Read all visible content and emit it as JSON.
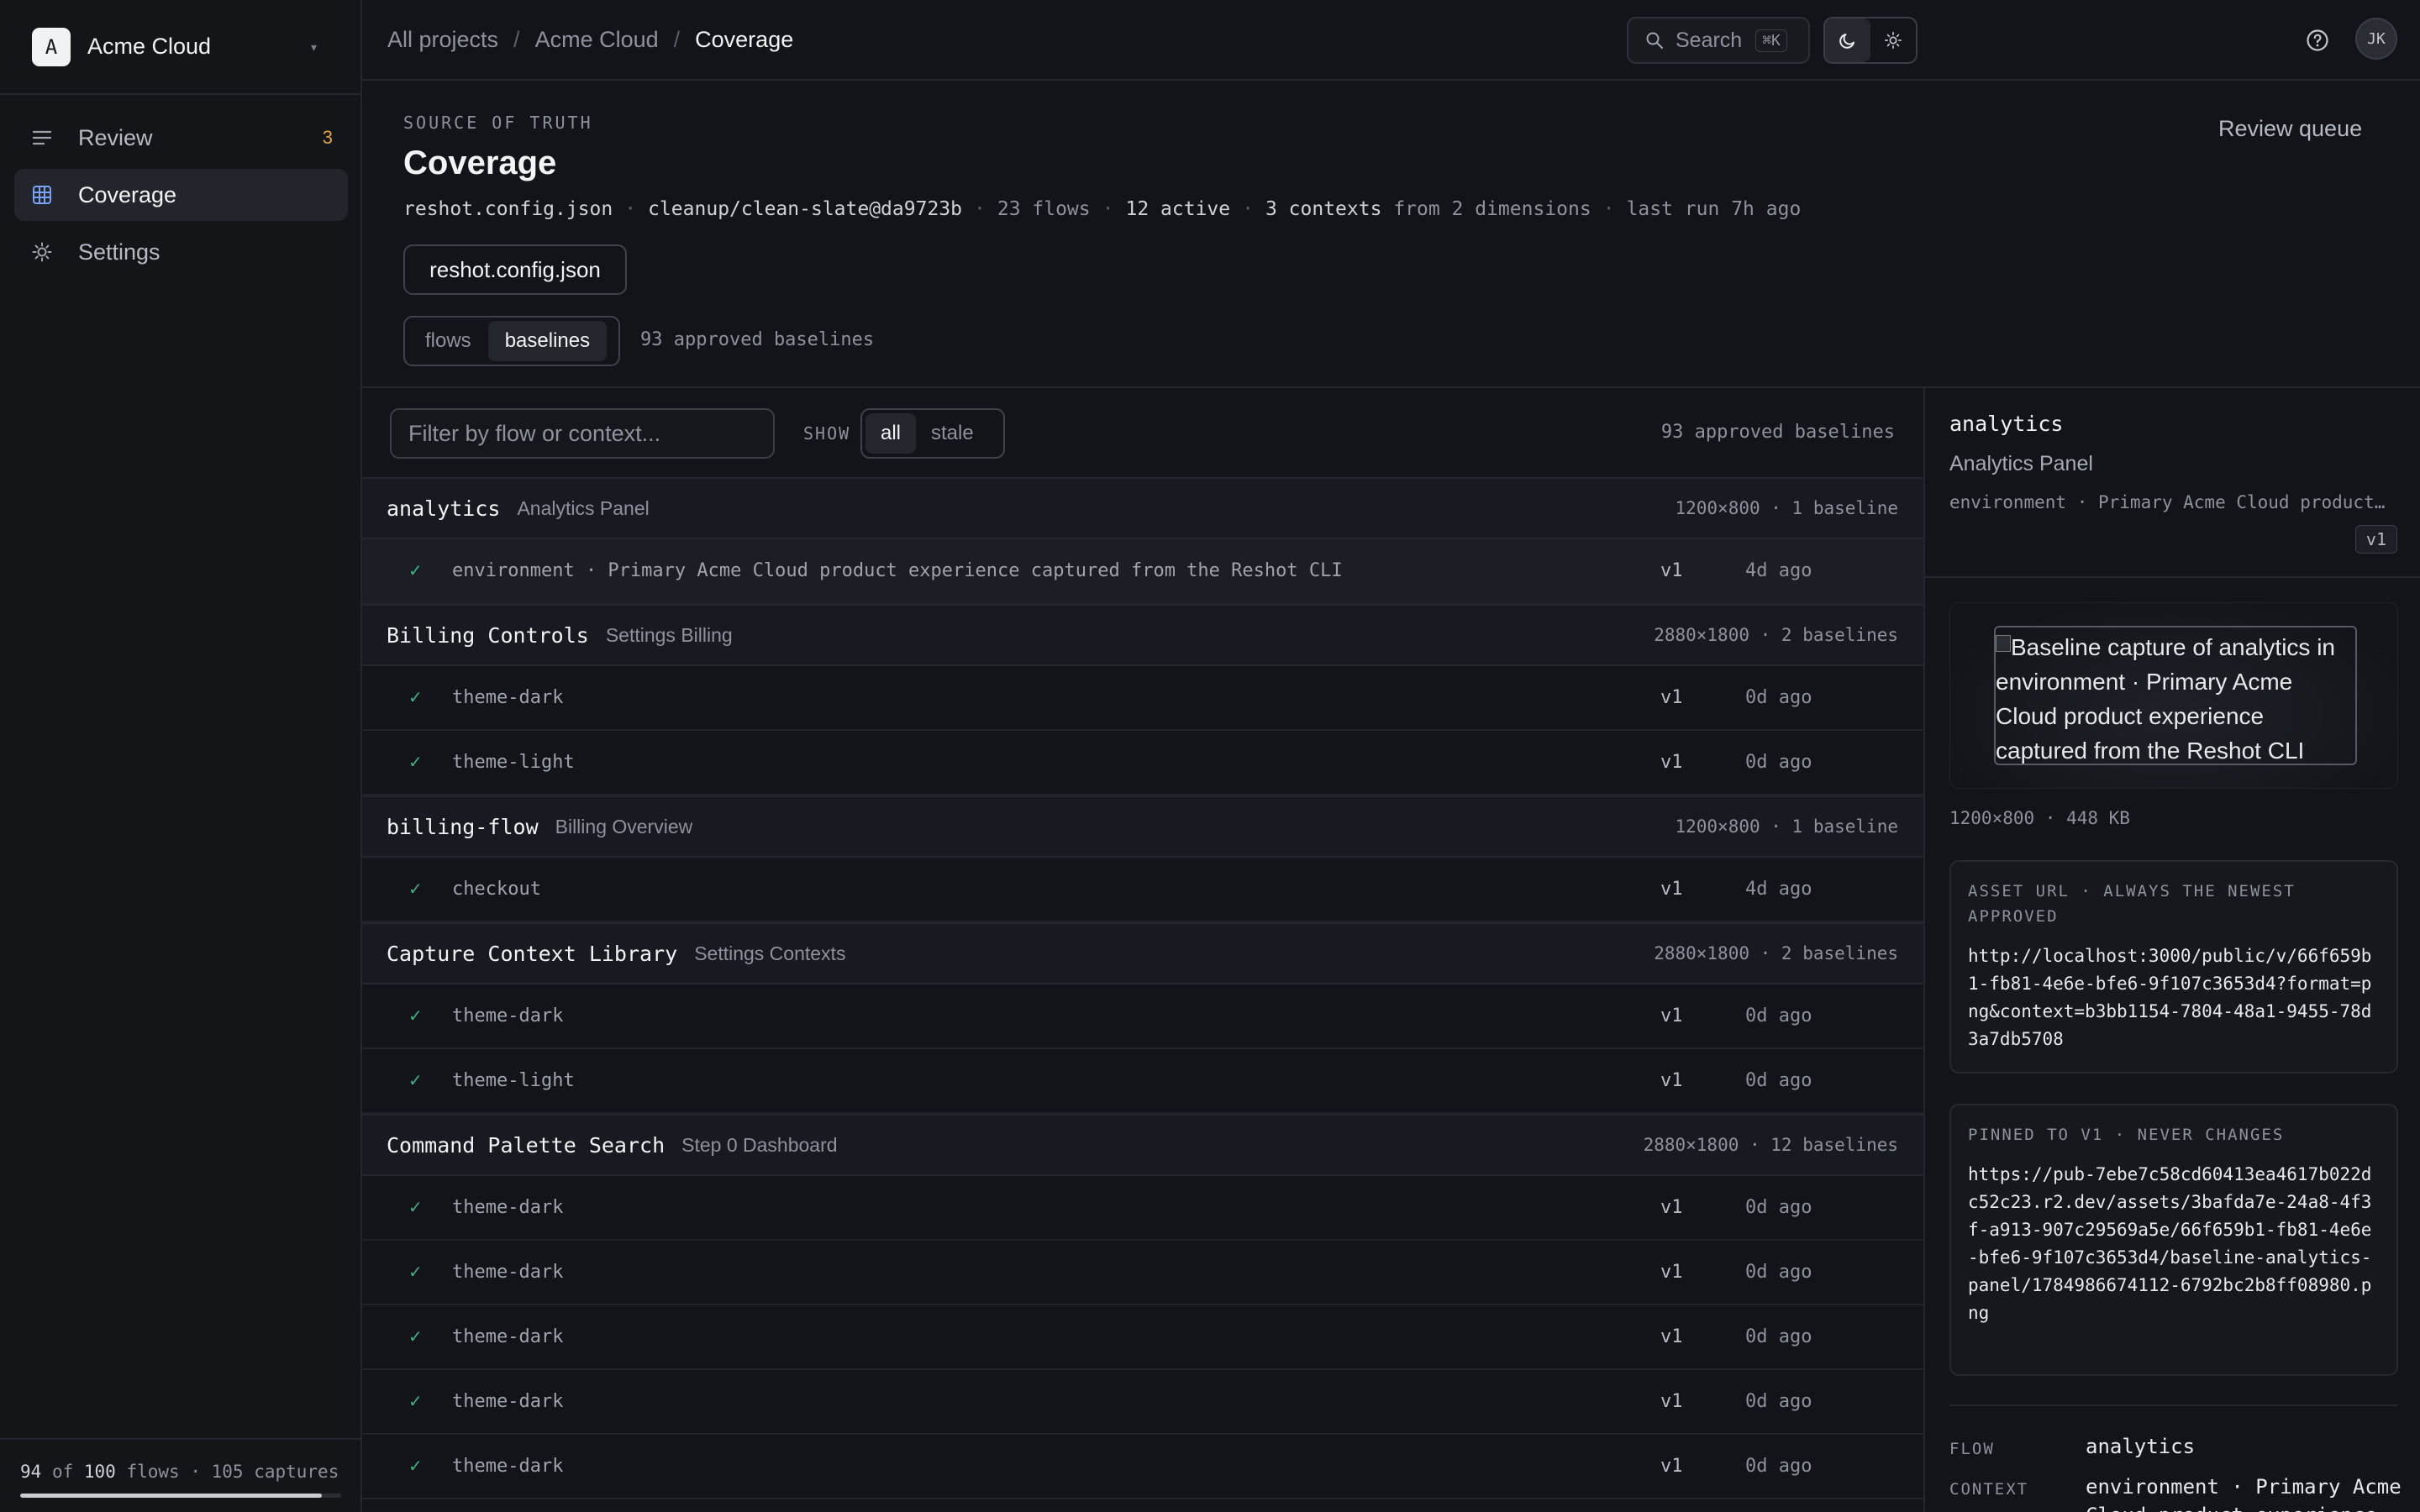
{
  "workspace": {
    "initial": "A",
    "name": "Acme Cloud"
  },
  "sidebar": {
    "items": [
      {
        "label": "Review",
        "icon": "list-icon",
        "badge": "3"
      },
      {
        "label": "Coverage",
        "icon": "grid-icon",
        "active": true
      },
      {
        "label": "Settings",
        "icon": "sun-gear-icon"
      }
    ],
    "footer": {
      "flows_done": "94",
      "flows_total": "100",
      "captures": "105",
      "text_mid": " of ",
      "text_flows": " flows · ",
      "text_captures": " captures",
      "progress": 0.94
    }
  },
  "breadcrumb": [
    "All projects",
    "Acme Cloud",
    "Coverage"
  ],
  "topbar": {
    "search_label": "Search",
    "search_shortcut": "⌘K",
    "avatar": "JK"
  },
  "header": {
    "eyebrow": "SOURCE OF TRUTH",
    "title": "Coverage",
    "review_queue": "Review queue",
    "meta": {
      "config": "reshot.config.json",
      "branch": "cleanup/clean-slate@da9723b",
      "flows": "23 flows",
      "active": "12 active",
      "contexts": "3 contexts",
      "contexts_suffix": "from 2 dimensions",
      "last_run": "last run 7h ago"
    },
    "config_button": "reshot.config.json",
    "view_options": [
      "flows",
      "baselines"
    ],
    "view_selected": "baselines",
    "approved_note": "93 approved baselines"
  },
  "list": {
    "filter_placeholder": "Filter by flow or context...",
    "show_label": "SHOW",
    "show_options": [
      "all",
      "stale"
    ],
    "count": "93 approved baselines",
    "groups": [
      {
        "name": "analytics",
        "sub": "Analytics Panel",
        "meta": "1200×800 · 1 baseline",
        "rows": [
          {
            "context": "environment · Primary Acme Cloud product experience captured from the Reshot CLI",
            "version": "v1",
            "age": "4d ago",
            "selected": true
          }
        ]
      },
      {
        "name": "Billing Controls",
        "sub": "Settings Billing",
        "meta": "2880×1800 · 2 baselines",
        "rows": [
          {
            "context": "theme-dark",
            "version": "v1",
            "age": "0d ago"
          },
          {
            "context": "theme-light",
            "version": "v1",
            "age": "0d ago"
          }
        ]
      },
      {
        "name": "billing-flow",
        "sub": "Billing Overview",
        "meta": "1200×800 · 1 baseline",
        "rows": [
          {
            "context": "checkout",
            "version": "v1",
            "age": "4d ago"
          }
        ]
      },
      {
        "name": "Capture Context Library",
        "sub": "Settings Contexts",
        "meta": "2880×1800 · 2 baselines",
        "rows": [
          {
            "context": "theme-dark",
            "version": "v1",
            "age": "0d ago"
          },
          {
            "context": "theme-light",
            "version": "v1",
            "age": "0d ago"
          }
        ]
      },
      {
        "name": "Command Palette Search",
        "sub": "Step 0 Dashboard",
        "meta": "2880×1800 · 12 baselines",
        "rows": [
          {
            "context": "theme-dark",
            "version": "v1",
            "age": "0d ago"
          },
          {
            "context": "theme-dark",
            "version": "v1",
            "age": "0d ago"
          },
          {
            "context": "theme-dark",
            "version": "v1",
            "age": "0d ago"
          },
          {
            "context": "theme-dark",
            "version": "v1",
            "age": "0d ago"
          },
          {
            "context": "theme-dark",
            "version": "v1",
            "age": "0d ago"
          }
        ]
      }
    ]
  },
  "detail": {
    "flow": "analytics",
    "subtitle": "Analytics Panel",
    "context": "environment · Primary Acme Cloud product experience captured from the Reshot CLI",
    "version": "v1",
    "preview_alt": "Baseline capture of analytics in environment · Primary Acme Cloud product experience captured from the Reshot CLI",
    "dims": "1200×800 · 448 KB",
    "asset_url_label": "ASSET URL · ALWAYS THE NEWEST APPROVED",
    "asset_url": "http://localhost:3000/public/v/66f659b1-fb81-4e6e-bfe6-9f107c3653d4?format=png&context=b3bb1154-7804-48a1-9455-78d3a7db5708",
    "pinned_label": "PINNED TO V1 · NEVER CHANGES",
    "pinned_url": "https://pub-7ebe7c58cd60413ea4617b022dc52c23.r2.dev/assets/3bafda7e-24a8-4f3f-a913-907c29569a5e/66f659b1-fb81-4e6e-bfe6-9f107c3653d4/baseline-analytics-panel/1784986674112-6792bc2b8ff08980.png",
    "kv": [
      {
        "key": "FLOW",
        "value": "analytics"
      },
      {
        "key": "CONTEXT",
        "value": "environment · Primary Acme Cloud product experience captured from the Reshot CLI"
      }
    ]
  },
  "colors": {
    "accent_check": "#3fb27f",
    "badge": "#e0a43d",
    "bg": "#121419"
  }
}
